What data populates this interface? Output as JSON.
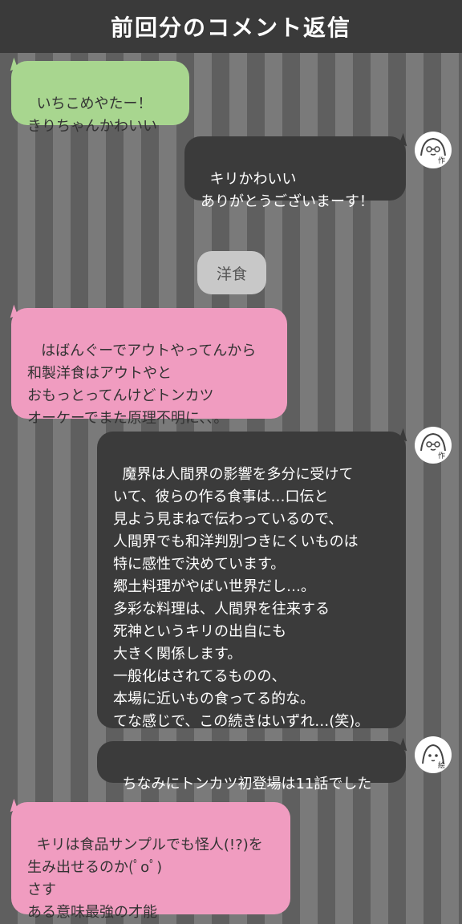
{
  "header": {
    "title": "前回分のコメント返信"
  },
  "messages": [
    {
      "side": "left",
      "color": "green",
      "text": "いちこめやたー！\nきりちゃんかわいい"
    },
    {
      "side": "right",
      "color": "dark",
      "text": "キリかわいい\nありがとうございまーす！",
      "avatar_tag": "作"
    },
    {
      "side": "center",
      "text": "洋食"
    },
    {
      "side": "left",
      "color": "pink",
      "text": " はばんぐーでアウトやってんから\n和製洋食はアウトやと\nおもっとってんけどトンカツ\nオーケーでまた原理不明に、、。"
    },
    {
      "side": "right",
      "color": "dark",
      "text": "魔界は人間界の影響を多分に受けて\nいて、彼らの作る食事は…口伝と\n見よう見まねで伝わっているので、\n人間界でも和洋判別つきにくいものは\n特に感性で決めています。\n郷土料理がやばい世界だし…。\n多彩な料理は、人間界を往来する\n死神というキリの出自にも\n大きく関係します。\n一般化はされてるものの、\n本場に近いもの食ってる的な。\nてな感じで、この続きはいずれ…(笑)。",
      "avatar_tag": "作"
    },
    {
      "side": "right",
      "color": "dark",
      "text": "ちなみにトンカツ初登場は11話でした",
      "avatar_tag": "絵"
    },
    {
      "side": "left",
      "color": "pink",
      "text": "キリは食品サンプルでも怪人(!?)を\n生み出せるのか(ﾟoﾟ)\nさす\nある意味最強の才能"
    }
  ],
  "colors": {
    "header_bg": "#3a3a3a",
    "green_bubble": "#a8d68f",
    "pink_bubble": "#f09cc0",
    "dark_bubble": "#3b3b3b",
    "chip_bg": "#c8c8c8"
  },
  "icons": [
    "author-avatar-icon",
    "artist-avatar-icon"
  ]
}
